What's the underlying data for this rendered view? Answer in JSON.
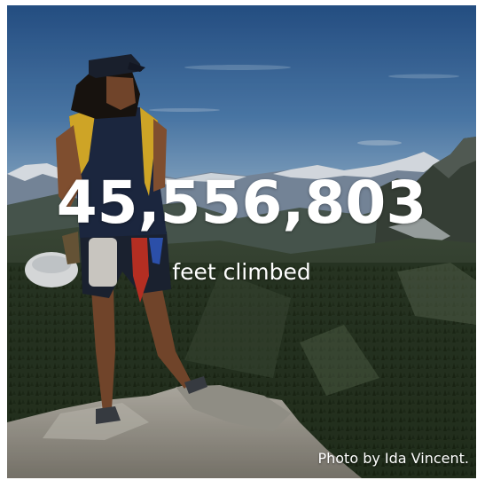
{
  "stat": {
    "value": "45,556,803",
    "label": "feet climbed"
  },
  "photo_credit": "Photo by Ida Vincent.",
  "colors": {
    "sky_top": "#2b5a93",
    "sky_bottom": "#8fb3cf",
    "text": "#ffffff"
  }
}
